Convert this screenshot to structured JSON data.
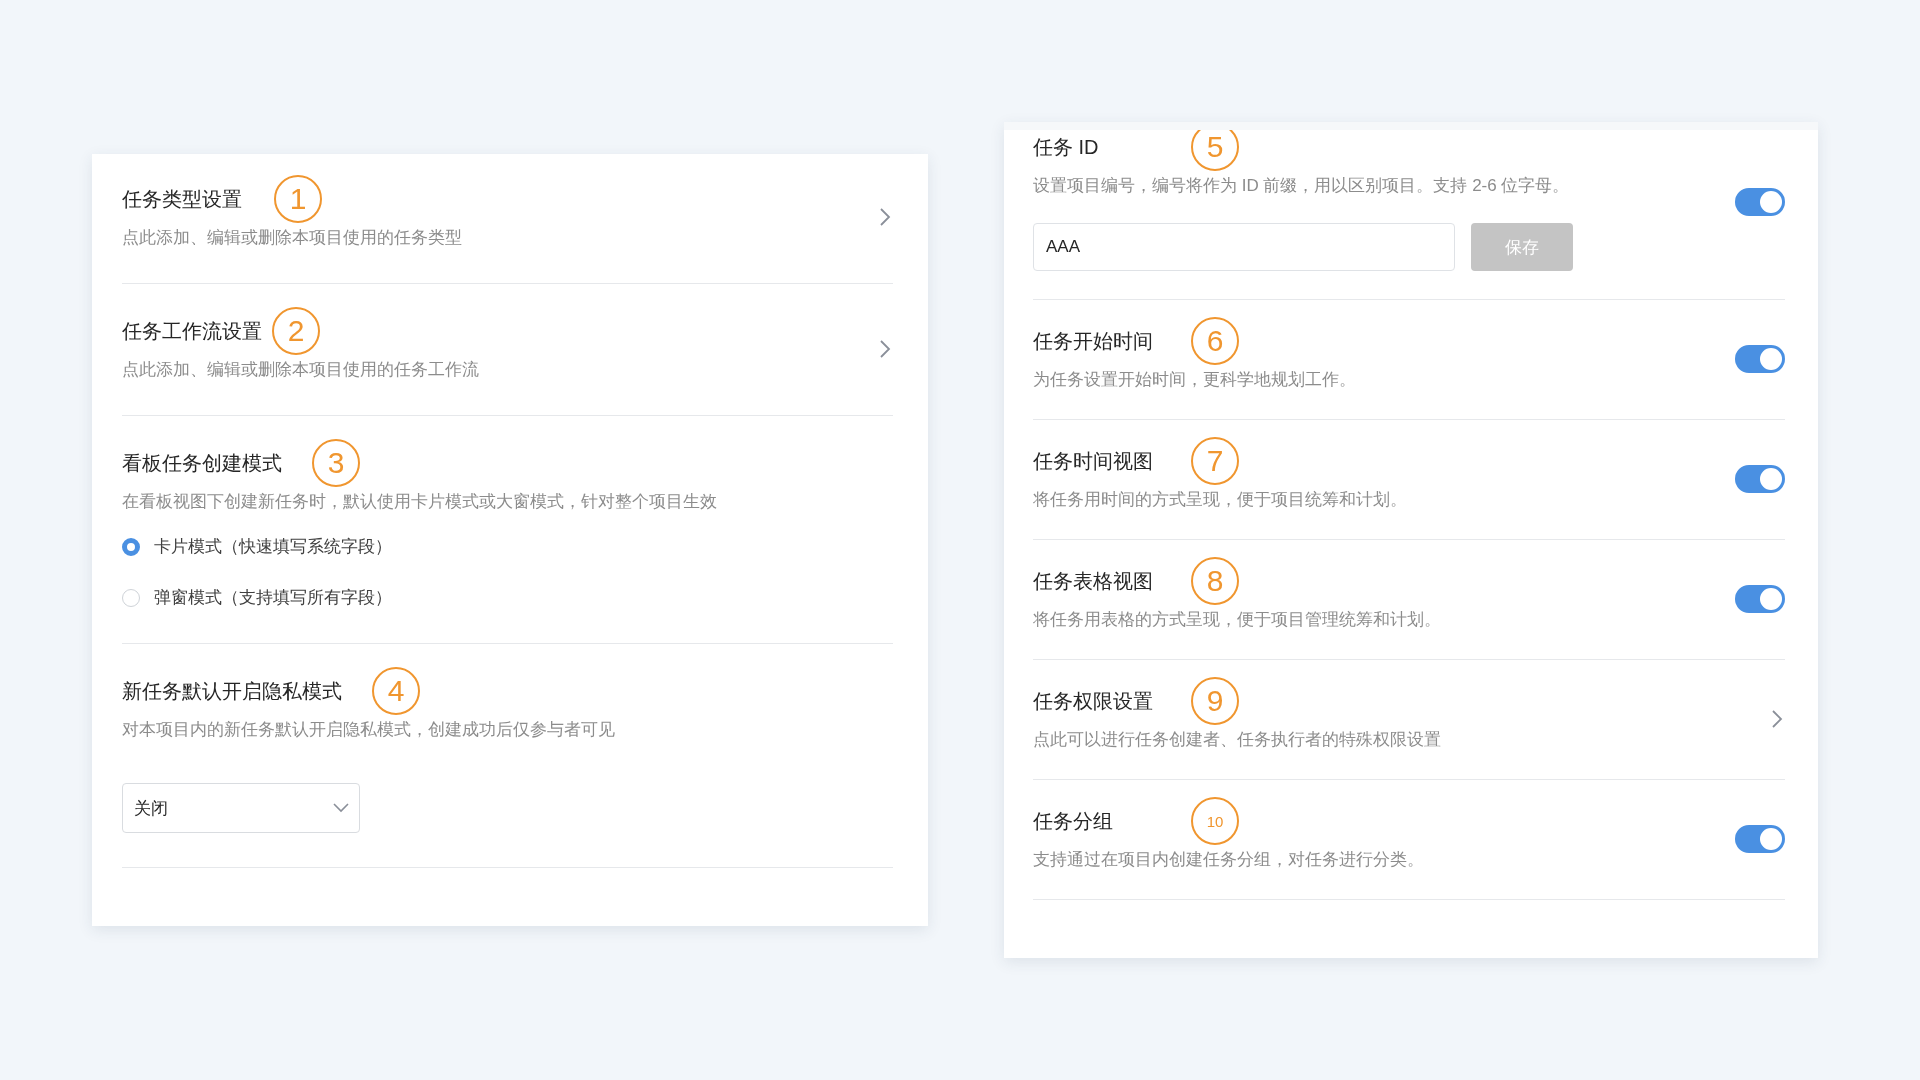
{
  "left_panel": {
    "items": [
      {
        "kind": "link",
        "title": "任务类型设置",
        "marker": "1",
        "description": "点此添加、编辑或删除本项目使用的任务类型"
      },
      {
        "kind": "link",
        "title": "任务工作流设置",
        "marker": "2",
        "description": "点此添加、编辑或删除本项目使用的任务工作流"
      },
      {
        "kind": "radio",
        "title": "看板任务创建模式",
        "marker": "3",
        "description": "在看板视图下创建新任务时，默认使用卡片模式或大窗模式，针对整个项目生效",
        "options": [
          {
            "label": "卡片模式（快速填写系统字段）",
            "selected": true
          },
          {
            "label": "弹窗模式（支持填写所有字段）",
            "selected": false
          }
        ]
      },
      {
        "kind": "select",
        "title": "新任务默认开启隐私模式",
        "marker": "4",
        "description": "对本项目内的新任务默认开启隐私模式，创建成功后仅参与者可见",
        "value": "关闭"
      }
    ]
  },
  "right_panel": {
    "items": [
      {
        "kind": "toggle",
        "title": "任务 ID",
        "marker": "5",
        "description": "设置项目编号，编号将作为 ID 前缀，用以区别项目。支持 2-6 位字母。",
        "on": true,
        "input_value": "AAA",
        "button": "保存"
      },
      {
        "kind": "toggle",
        "title": "任务开始时间",
        "marker": "6",
        "description": "为任务设置开始时间，更科学地规划工作。",
        "on": true
      },
      {
        "kind": "toggle",
        "title": "任务时间视图",
        "marker": "7",
        "description": "将任务用时间的方式呈现，便于项目统筹和计划。",
        "on": true
      },
      {
        "kind": "toggle",
        "title": "任务表格视图",
        "marker": "8",
        "description": "将任务用表格的方式呈现，便于项目管理统筹和计划。",
        "on": true
      },
      {
        "kind": "link",
        "title": "任务权限设置",
        "marker": "9",
        "description": "点此可以进行任务创建者、任务执行者的特殊权限设置"
      },
      {
        "kind": "toggle",
        "title": "任务分组",
        "marker": "10",
        "description": "支持通过在项目内创建任务分组，对任务进行分类。",
        "on": true
      }
    ]
  }
}
